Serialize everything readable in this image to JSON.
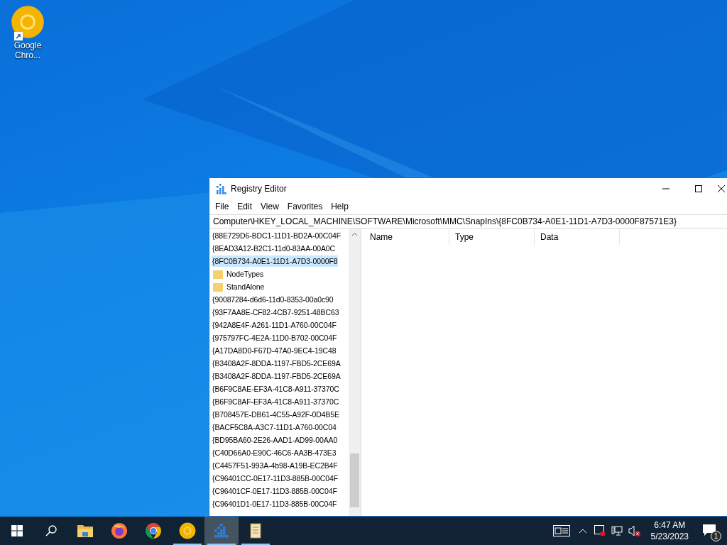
{
  "desktop_icons": [
    {
      "label": "Google Chro..."
    }
  ],
  "window": {
    "title": "Registry Editor"
  },
  "menu": [
    "File",
    "Edit",
    "View",
    "Favorites",
    "Help"
  ],
  "address": "Computer\\HKEY_LOCAL_MACHINE\\SOFTWARE\\Microsoft\\MMC\\SnapIns\\{8FC0B734-A0E1-11D1-A7D3-0000F87571E3}",
  "tree": [
    {
      "label": "{88E729D6-BDC1-11D1-BD2A-00C04F",
      "selected": false
    },
    {
      "label": "{8EAD3A12-B2C1-11d0-83AA-00A0C",
      "selected": false
    },
    {
      "label": "{8FC0B734-A0E1-11D1-A7D3-0000F8",
      "selected": true,
      "children": [
        {
          "label": "NodeTypes",
          "selected": false
        },
        {
          "label": "StandAlone",
          "selected": false
        }
      ]
    },
    {
      "label": "{90087284-d6d6-11d0-8353-00a0c90",
      "selected": false
    },
    {
      "label": "{93F7AA8E-CF82-4CB7-9251-48BC63",
      "selected": false
    },
    {
      "label": "{942A8E4F-A261-11D1-A760-00C04F",
      "selected": false
    },
    {
      "label": "{975797FC-4E2A-11D0-B702-00C04F",
      "selected": false
    },
    {
      "label": "{A17DA8D0-F67D-47A0-9EC4-19C48",
      "selected": false
    },
    {
      "label": "{B3408A2F-8DDA-1197-FBD5-2CE69A",
      "selected": false
    },
    {
      "label": "{B3408A2F-8DDA-1197-FBD5-2CE69A",
      "selected": false
    },
    {
      "label": "{B6F9C8AE-EF3A-41C8-A911-37370C",
      "selected": false
    },
    {
      "label": "{B6F9C8AF-EF3A-41C8-A911-37370C",
      "selected": false
    },
    {
      "label": "{B708457E-DB61-4C55-A92F-0D4B5E",
      "selected": false
    },
    {
      "label": "{BACF5C8A-A3C7-11D1-A760-00C04",
      "selected": false
    },
    {
      "label": "{BD95BA60-2E26-AAD1-AD99-00AA0",
      "selected": false
    },
    {
      "label": "{C40D66A0-E90C-46C6-AA3B-473E3",
      "selected": false
    },
    {
      "label": "{C4457F51-993A-4b98-A19B-EC2B4F",
      "selected": false
    },
    {
      "label": "{C96401CC-0E17-11D3-885B-00C04F",
      "selected": false
    },
    {
      "label": "{C96401CF-0E17-11D3-885B-00C04F",
      "selected": false
    },
    {
      "label": "{C96401D1-0E17-11D3-885B-00C04F",
      "selected": false
    }
  ],
  "columns": [
    "Name",
    "Type",
    "Data"
  ],
  "taskbar": {
    "apps": [
      {
        "kind": "folder",
        "running": false,
        "selected": false
      },
      {
        "kind": "firefox",
        "running": false,
        "selected": false
      },
      {
        "kind": "chrome",
        "running": false,
        "selected": false
      },
      {
        "kind": "canary",
        "running": true,
        "selected": false
      },
      {
        "kind": "regedit",
        "running": true,
        "selected": true
      },
      {
        "kind": "scroll",
        "running": true,
        "selected": false
      }
    ],
    "time": "6:47 AM",
    "date": "5/23/2023",
    "notifications": "1"
  }
}
